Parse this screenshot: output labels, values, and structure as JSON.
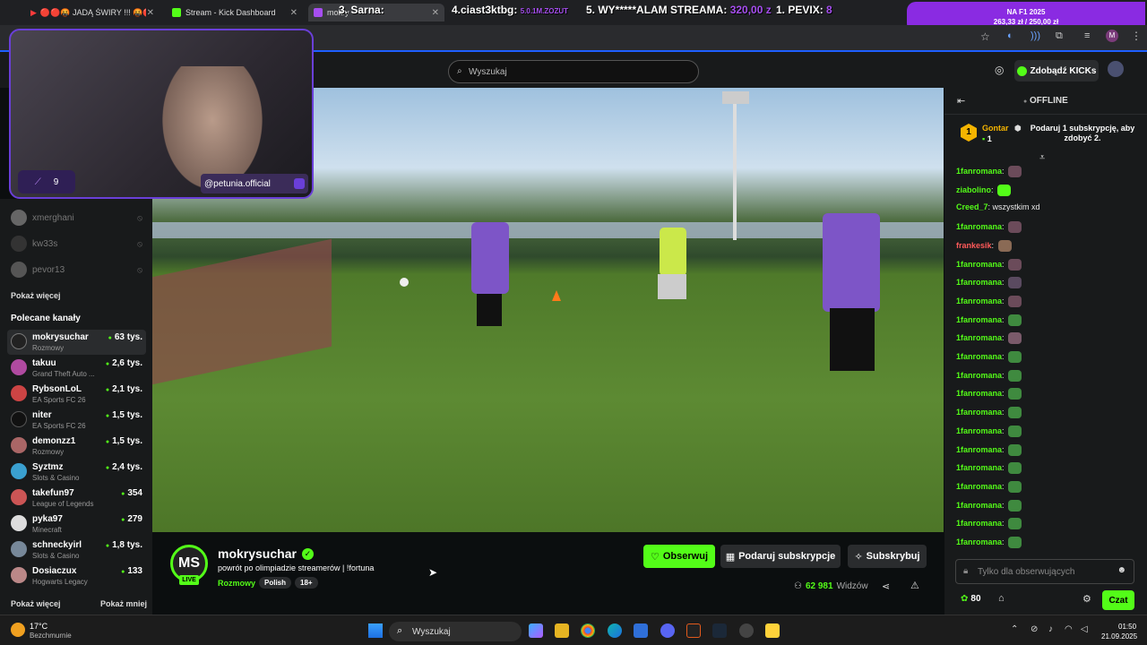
{
  "browser": {
    "tabs": [
      {
        "label": "🔴🔴🤬 JADĄ ŚWIRY !!! 🤬🔴🔴#2",
        "close": "✕"
      },
      {
        "label": "Stream - Kick Dashboard",
        "close": "✕"
      },
      {
        "label": "mokry",
        "close": "✕"
      }
    ],
    "overlay_items": [
      {
        "text": "3. Sarna:",
        "money": ""
      },
      {
        "text": "4.ciast3ktbg:",
        "money": "5.0.1M.ZOZUT"
      },
      {
        "text": "5. WY*****ALAM STREAMA:",
        "money": "320,00 z"
      },
      {
        "text": "1. PEVIX:",
        "money": "8"
      }
    ],
    "goal": {
      "title": "NA F1 2025",
      "progress_text": "263,33 zł / 250,00 zł",
      "progress_pct": 105
    }
  },
  "header": {
    "search_placeholder": "Wyszukaj",
    "kicks_button": "Zdobądź KICKs"
  },
  "webcam": {
    "handle": "@petunia.official",
    "badge_count": "9"
  },
  "sidebar": {
    "offline_channels": [
      {
        "name": "xmerghani"
      },
      {
        "name": "kw33s"
      },
      {
        "name": "pevor13"
      }
    ],
    "show_more": "Pokaż więcej",
    "recommended_title": "Polecane kanały",
    "recommended": [
      {
        "name": "mokrysuchar",
        "category": "Rozmowy",
        "viewers": "63 tys."
      },
      {
        "name": "takuu",
        "category": "Grand Theft Auto ...",
        "viewers": "2,6 tys."
      },
      {
        "name": "RybsonLoL",
        "category": "EA Sports FC 26",
        "viewers": "2,1 tys."
      },
      {
        "name": "niter",
        "category": "EA Sports FC 26",
        "viewers": "1,5 tys."
      },
      {
        "name": "demonzz1",
        "category": "Rozmowy",
        "viewers": "1,5 tys."
      },
      {
        "name": "Syztmz",
        "category": "Slots & Casino",
        "viewers": "2,4 tys."
      },
      {
        "name": "takefun97",
        "category": "League of Legends",
        "viewers": "354"
      },
      {
        "name": "pyka97",
        "category": "Minecraft",
        "viewers": "279"
      },
      {
        "name": "schneckyirl",
        "category": "Slots & Casino",
        "viewers": "1,8 tys."
      },
      {
        "name": "Dosiaczux",
        "category": "Hogwarts Legacy",
        "viewers": "133"
      }
    ],
    "show_more_bottom": "Pokaż więcej",
    "show_less": "Pokaż mniej"
  },
  "stream": {
    "avatar_text": "MS",
    "live_label": "LIVE",
    "channel": "mokrysuchar",
    "title": "powrót po olimpiadzie streamerów | !fortuna",
    "category": "Rozmowy",
    "tags": [
      "Polish",
      "18+"
    ],
    "follow": "Obserwuj",
    "gift_sub": "Podaruj subskrypcje",
    "subscribe": "Subskrybuj",
    "viewers": "62 981",
    "viewers_label": "Widzów"
  },
  "chat": {
    "status": "OFFLINE",
    "pinned_user": "Gontar",
    "pinned_count": "1",
    "pinned_rank": "1",
    "pinned_text": "Podaruj 1 subskrypcję, aby zdobyć 2.",
    "messages": [
      {
        "user": "1fanromana",
        "text": "",
        "color": "#53fc18",
        "emote": "#6b4b5a"
      },
      {
        "user": "ziabolino",
        "text": "",
        "color": "#53fc18",
        "emote": "#53fc18"
      },
      {
        "user": "Creed_7",
        "text": "wszystkim xd",
        "color": "#53fc18",
        "emote": ""
      },
      {
        "user": "1fanromana",
        "text": "",
        "color": "#53fc18",
        "emote": "#6b4b5a"
      },
      {
        "user": "frankesik",
        "text": "",
        "color": "#ff5a5a",
        "emote": "#8a6a55"
      },
      {
        "user": "1fanromana",
        "text": "",
        "color": "#53fc18",
        "emote": "#6b4b5a"
      },
      {
        "user": "1fanromana",
        "text": "",
        "color": "#53fc18",
        "emote": "#5a4a60"
      },
      {
        "user": "1fanromana",
        "text": "",
        "color": "#53fc18",
        "emote": "#6b4b5a"
      },
      {
        "user": "1fanromana",
        "text": "",
        "color": "#53fc18",
        "emote": "#3f8a3f"
      },
      {
        "user": "1fanromana",
        "text": "",
        "color": "#53fc18",
        "emote": "#7a5a6a"
      },
      {
        "user": "1fanromana",
        "text": "",
        "color": "#53fc18",
        "emote": "#3f8a3f"
      },
      {
        "user": "1fanromana",
        "text": "",
        "color": "#53fc18",
        "emote": "#3f8a3f"
      },
      {
        "user": "1fanromana",
        "text": "",
        "color": "#53fc18",
        "emote": "#3f8a3f"
      },
      {
        "user": "1fanromana",
        "text": "",
        "color": "#53fc18",
        "emote": "#3f8a3f"
      },
      {
        "user": "1fanromana",
        "text": "",
        "color": "#53fc18",
        "emote": "#3f8a3f"
      },
      {
        "user": "1fanromana",
        "text": "",
        "color": "#53fc18",
        "emote": "#3f8a3f"
      },
      {
        "user": "1fanromana",
        "text": "",
        "color": "#53fc18",
        "emote": "#3f8a3f"
      },
      {
        "user": "1fanromana",
        "text": "",
        "color": "#53fc18",
        "emote": "#3f8a3f"
      },
      {
        "user": "1fanromana",
        "text": "",
        "color": "#53fc18",
        "emote": "#3f8a3f"
      },
      {
        "user": "1fanromana",
        "text": "",
        "color": "#53fc18",
        "emote": "#3f8a3f"
      },
      {
        "user": "1fanromana",
        "text": "",
        "color": "#53fc18",
        "emote": "#3f8a3f"
      }
    ],
    "input_placeholder": "Tylko dla obserwujących",
    "points": "80",
    "send": "Czat"
  },
  "taskbar": {
    "weather_temp": "17°C",
    "weather_desc": "Bezchmurnie",
    "search": "Wyszukaj",
    "time": "01:50",
    "date": "21.09.2025"
  },
  "colors": {
    "kick_green": "#53fc18",
    "overlay_purple": "#8a2be2",
    "bg": "#0b0e0f",
    "panel": "#181a1b"
  }
}
